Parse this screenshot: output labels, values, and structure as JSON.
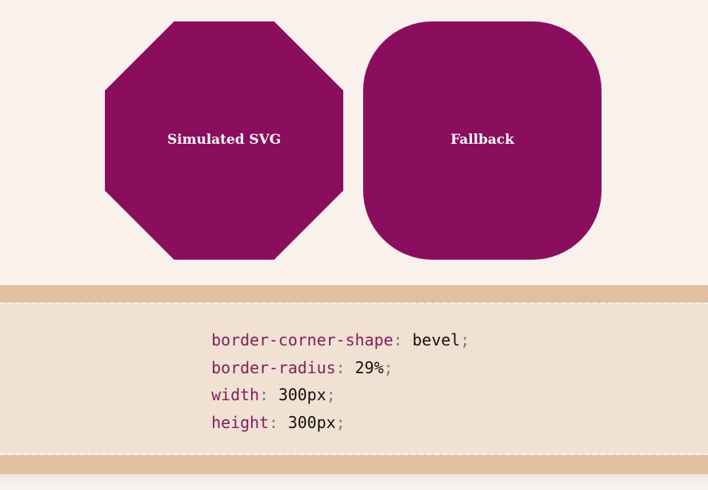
{
  "shapes": {
    "simulated_label": "Simulated SVG",
    "fallback_label": "Fallback",
    "color": "#8b0e5e"
  },
  "code": {
    "lines": [
      {
        "property": "border-corner-shape",
        "value": "bevel"
      },
      {
        "property": "border-radius",
        "value": "29%"
      },
      {
        "property": "width",
        "value": "300px"
      },
      {
        "property": "height",
        "value": "300px"
      }
    ]
  }
}
